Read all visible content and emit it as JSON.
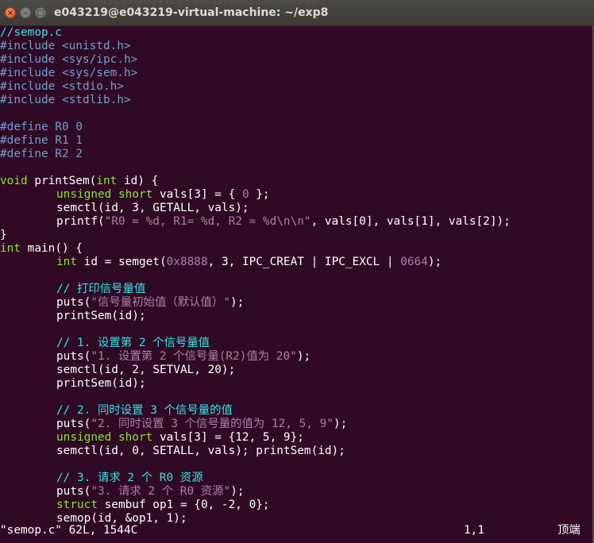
{
  "window": {
    "title": "e043219@e043219-virtual-machine: ~/exp8",
    "ghost_title": "e043219@e043219-virtual-machine: ~/exp8",
    "close_glyph": "×",
    "min_glyph": "–",
    "max_glyph": "□"
  },
  "code": {
    "l01": "//semop.c",
    "l02": "#include <unistd.h>",
    "l03": "#include <sys/ipc.h>",
    "l04": "#include <sys/sem.h>",
    "l05": "#include <stdio.h>",
    "l06": "#include <stdlib.h>",
    "l08": "#define R0 0",
    "l09": "#define R1 1",
    "l10": "#define R2 2",
    "l12a": "void",
    "l12b": " printSem(",
    "l12c": "int",
    "l12d": " id) {",
    "l13a": "unsigned short",
    "l13b": " vals[3] = { ",
    "l13c": "0",
    "l13d": " };",
    "l14": "semctl(id, 3, GETALL, vals);",
    "l15a": "printf(",
    "l15b": "\"R0 = %d, R1= %d, R2 = %d\\n\\n\"",
    "l15c": ", vals[0], vals[1], vals[2]);",
    "l16": "}",
    "l17a": "int",
    "l17b": " main() {",
    "l18a": "int",
    "l18b": " id = semget(",
    "l18c": "0x8888",
    "l18d": ", 3, IPC_CREAT | IPC_EXCL | ",
    "l18e": "0664",
    "l18f": ");",
    "l20": "// 打印信号量值",
    "l21a": "puts(",
    "l21b": "\"信号量初始值（默认值）\"",
    "l21c": ");",
    "l22": "printSem(id);",
    "l24": "// 1. 设置第 2 个信号量值",
    "l25a": "puts(",
    "l25b": "\"1. 设置第 2 个信号量(R2)值为 20\"",
    "l25c": ");",
    "l26": "semctl(id, 2, SETVAL, 20);",
    "l27": "printSem(id);",
    "l29": "// 2. 同时设置 3 个信号量的值",
    "l30a": "puts(",
    "l30b": "\"2. 同时设置 3 个信号量的值为 12, 5, 9\"",
    "l30c": ");",
    "l31a": "unsigned short",
    "l31b": " vals[3] = {12, 5, 9};",
    "l32": "semctl(id, 0, SETALL, vals); printSem(id);",
    "l34": "// 3. 请求 2 个 R0 资源",
    "l35a": "puts(",
    "l35b": "\"3. 请求 2 个 R0 资源\"",
    "l35c": ");",
    "l36a": "struct",
    "l36b": " sembuf op1 = {0, -2, 0};",
    "l37": "semop(id, &op1, 1);"
  },
  "status": {
    "file": "\"semop.c\" 62L, 1544C",
    "position": "1,1",
    "scroll": "顶端"
  }
}
